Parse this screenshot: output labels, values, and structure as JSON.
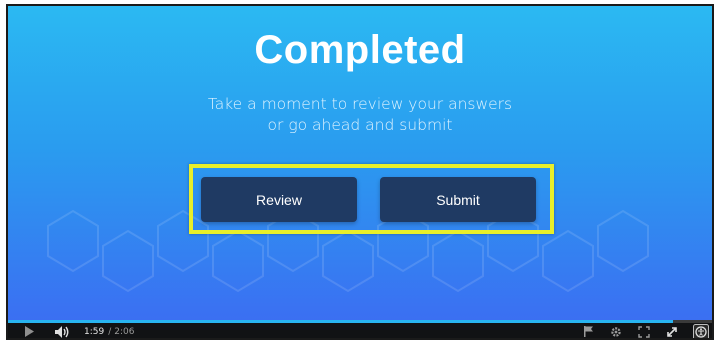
{
  "slide": {
    "title": "Completed",
    "subtitle_line1": "Take a moment to review your answers",
    "subtitle_line2": "or go ahead and submit",
    "review_label": "Review",
    "submit_label": "Submit"
  },
  "player": {
    "current_time": "1:59",
    "separator": "/",
    "duration": "2:06",
    "progress_fraction": 0.944
  },
  "colors": {
    "button_bg": "#1f3a63",
    "highlight": "#e9ef2a",
    "progress": "#28b4f0"
  },
  "icons": [
    "play-icon",
    "volume-icon",
    "flag-icon",
    "settings-icon",
    "fullscreen-icon",
    "expand-icon",
    "accessibility-icon"
  ]
}
